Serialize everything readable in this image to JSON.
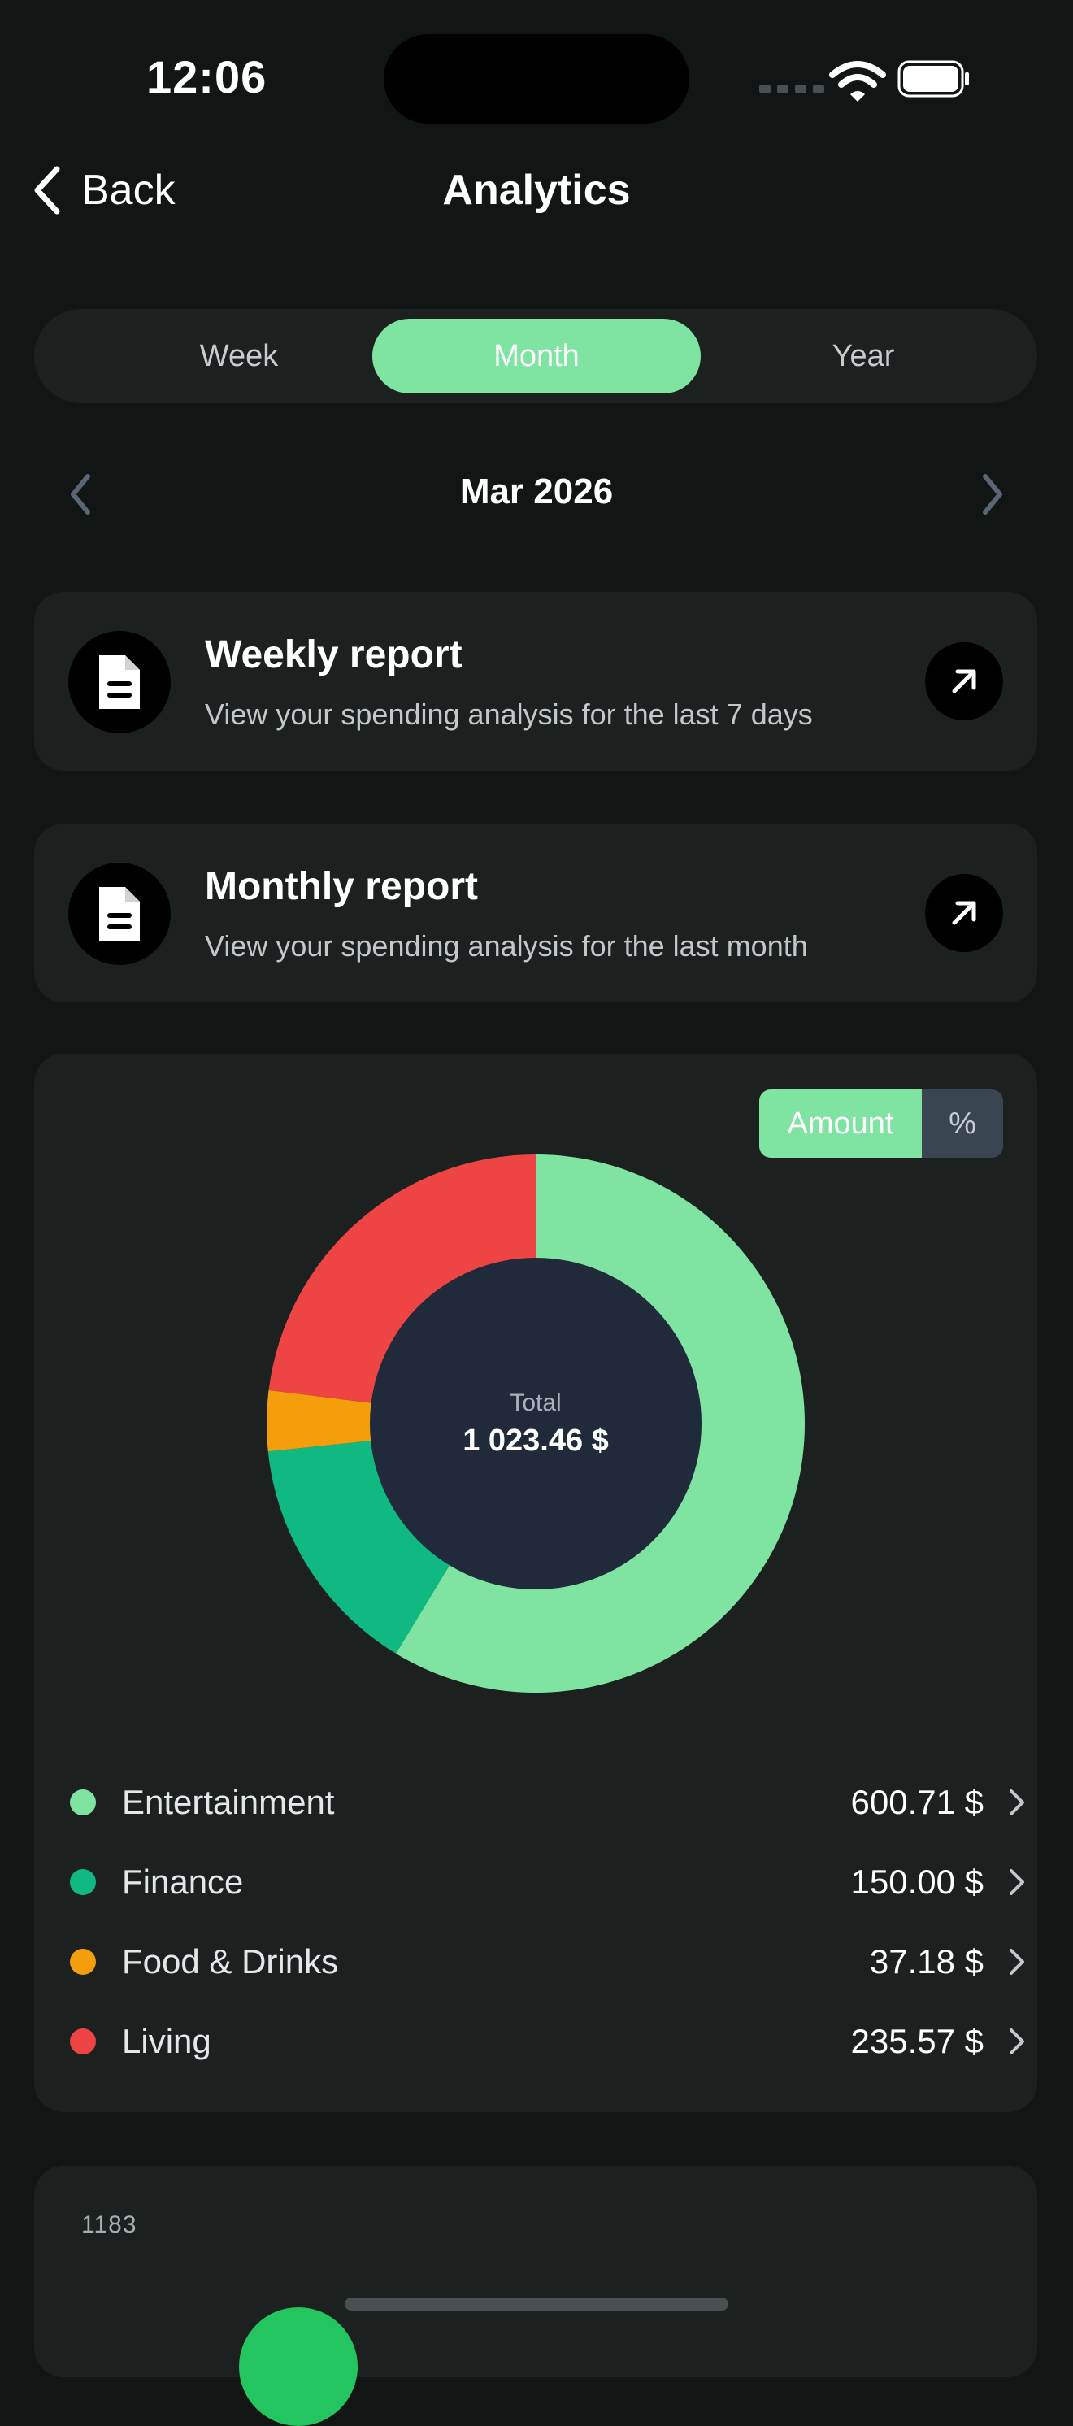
{
  "status_bar": {
    "time": "12:06"
  },
  "nav": {
    "back_label": "Back",
    "title": "Analytics"
  },
  "segments": [
    {
      "label": "Week",
      "active": false
    },
    {
      "label": "Month",
      "active": true
    },
    {
      "label": "Year",
      "active": false
    }
  ],
  "period": {
    "label": "Mar 2026"
  },
  "reports": [
    {
      "title": "Weekly report",
      "subtitle": "View your spending analysis for the last 7 days"
    },
    {
      "title": "Monthly report",
      "subtitle": "View your spending analysis for the last month"
    }
  ],
  "toggle": {
    "amount_label": "Amount",
    "percent_label": "%"
  },
  "chart_data": {
    "type": "pie",
    "center_label": "Total",
    "center_value": "1 023.46 $",
    "categories": [
      "Entertainment",
      "Finance",
      "Food & Drinks",
      "Living"
    ],
    "values": [
      600.71,
      150.0,
      37.18,
      235.57
    ],
    "display_values": [
      "600.71 $",
      "150.00 $",
      "37.18 $",
      "235.57 $"
    ],
    "colors": [
      "#7fe3a2",
      "#10b981",
      "#f59e0b",
      "#ef4444"
    ]
  },
  "bottom_chart": {
    "axis_max_label": "1183"
  },
  "colors": {
    "accent": "#7fe3a2",
    "background": "#111614",
    "card": "#1c2120",
    "donut_hole": "#212a3a"
  }
}
